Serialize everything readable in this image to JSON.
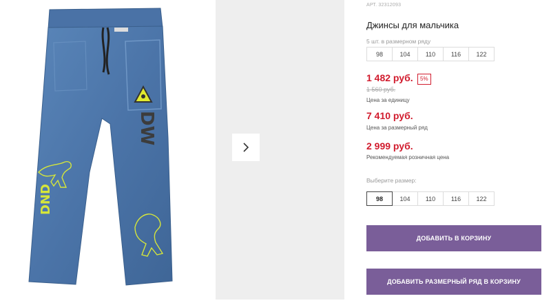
{
  "product": {
    "article": "АРТ. 32312093",
    "title": "Джинсы для мальчика",
    "row_note": "5 шт. в размерном ряду",
    "row_sizes": [
      "98",
      "104",
      "110",
      "116",
      "122"
    ],
    "price": "1 482 руб.",
    "discount": "5%",
    "old_price": "1 560 руб.",
    "price_caption": "Цена за единицу",
    "row_price": "7 410 руб.",
    "row_price_caption": "Цена за размерный ряд",
    "rrp": "2 999 руб.",
    "rrp_caption": "Рекомендуемая розничная цена",
    "select_size_label": "Выберите размер:",
    "sizes": [
      "98",
      "104",
      "110",
      "116",
      "122"
    ],
    "selected_size": "98"
  },
  "actions": {
    "add_to_cart": "ДОБАВИТЬ В КОРЗИНУ",
    "add_row_to_cart": "ДОБАВИТЬ РАЗМЕРНЫЙ РЯД В КОРЗИНУ"
  },
  "image": {
    "print_text": "DW",
    "leg_text": "DND",
    "colors": {
      "denim": "#4f79ad",
      "print": "#d6e63a",
      "accent": "#7a5e99",
      "price": "#d11b2d"
    }
  },
  "icons": {
    "next": "chevron-right-icon"
  }
}
